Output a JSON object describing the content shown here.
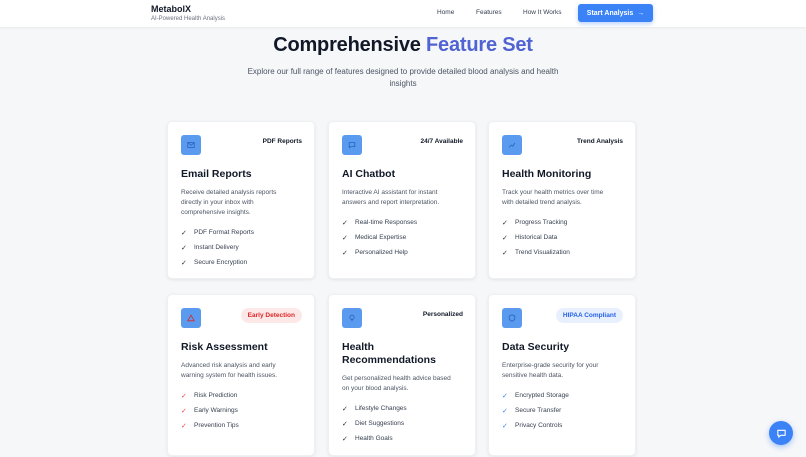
{
  "header": {
    "brand": "MetabolX",
    "tagline": "AI-Powered Health Analysis",
    "nav": [
      "Home",
      "Features",
      "How It Works"
    ],
    "cta": "Start Analysis",
    "cta_icon": "arrow-right-icon"
  },
  "hero": {
    "title_main": "Comprehensive ",
    "title_accent": "Feature Set",
    "subtitle": "Explore our full range of features designed to provide detailed blood analysis and health insights"
  },
  "colors": {
    "accent": "#4f63d2",
    "primary": "#3b82f6",
    "icon_bg": "#5b9bef",
    "danger": "#dc2626"
  },
  "cards": [
    {
      "icon": "mail-icon",
      "badge": "PDF Reports",
      "title": "Email Reports",
      "desc": "Receive detailed analysis reports directly in your inbox with comprehensive insights.",
      "items": [
        "PDF Format Reports",
        "Instant Delivery",
        "Secure Encryption"
      ]
    },
    {
      "icon": "chat-icon",
      "badge": "24/7 Available",
      "title": "AI Chatbot",
      "desc": "Interactive AI assistant for instant answers and report interpretation.",
      "items": [
        "Real-time Responses",
        "Medical Expertise",
        "Personalized Help"
      ]
    },
    {
      "icon": "chart-icon",
      "badge": "Trend Analysis",
      "title": "Health Monitoring",
      "desc": "Track your health metrics over time with detailed trend analysis.",
      "items": [
        "Progress Tracking",
        "Historical Data",
        "Trend Visualization"
      ]
    },
    {
      "icon": "alert-icon",
      "badge": "Early Detection",
      "title": "Risk Assessment",
      "desc": "Advanced risk analysis and early warning system for health issues.",
      "items": [
        "Risk Prediction",
        "Early Warnings",
        "Prevention Tips"
      ]
    },
    {
      "icon": "lightbulb-icon",
      "badge": "Personalized",
      "title": "Health Recommendations",
      "desc": "Get personalized health advice based on your blood analysis.",
      "items": [
        "Lifestyle Changes",
        "Diet Suggestions",
        "Health Goals"
      ]
    },
    {
      "icon": "shield-icon",
      "badge": "HIPAA Compliant",
      "title": "Data Security",
      "desc": "Enterprise-grade security for your sensitive health data.",
      "items": [
        "Encrypted Storage",
        "Secure Transfer",
        "Privacy Controls"
      ]
    }
  ],
  "chat_fab_icon": "chat-bubble-icon"
}
